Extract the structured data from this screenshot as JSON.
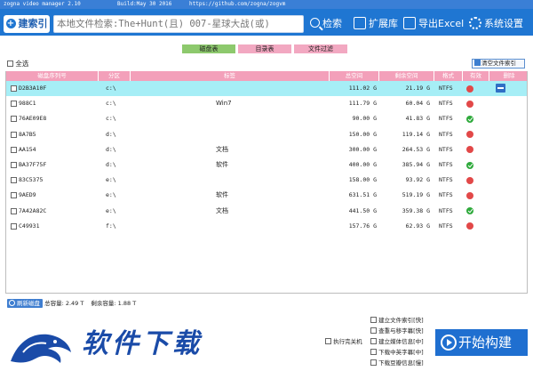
{
  "titlebar": {
    "app": "zogna video manager 2.10",
    "build": "Build:May 30 2016",
    "url": "https://github.com/zogna/zogvm"
  },
  "toolbar": {
    "build_index_label": "建索引",
    "search_placeholder": "本地文件检索:The+Hunt(且) 007-星球大战(或)",
    "search_label": "检索",
    "extensions_label": "扩展库",
    "export_label": "导出Excel",
    "settings_label": "系统设置"
  },
  "tabs": [
    {
      "label": "磁盘表"
    },
    {
      "label": "目录表"
    },
    {
      "label": "文件过滤"
    }
  ],
  "select_all_label": "全选",
  "clear_index_label": "清空文件索引",
  "columns": [
    "磁盘序列号",
    "分区",
    "标签",
    "总空间",
    "剩余空间",
    "格式",
    "有效",
    "删除"
  ],
  "rows": [
    {
      "serial": "D2B3A10F",
      "partition": "c:\\",
      "label": "",
      "total": "111.02 G",
      "free": "21.19 G",
      "format": "NTFS",
      "status": "red",
      "selected": true
    },
    {
      "serial": "988C1",
      "partition": "c:\\",
      "label": "Win7",
      "total": "111.79 G",
      "free": "60.04 G",
      "format": "NTFS",
      "status": "red",
      "selected": false
    },
    {
      "serial": "76AE09E8",
      "partition": "c:\\",
      "label": "",
      "total": "90.00 G",
      "free": "41.83 G",
      "format": "NTFS",
      "status": "green",
      "selected": false
    },
    {
      "serial": "8A7B5",
      "partition": "d:\\",
      "label": "",
      "total": "150.00 G",
      "free": "119.14 G",
      "format": "NTFS",
      "status": "red",
      "selected": false
    },
    {
      "serial": "AA154",
      "partition": "d:\\",
      "label": "文档",
      "total": "300.00 G",
      "free": "264.53 G",
      "format": "NTFS",
      "status": "red",
      "selected": false
    },
    {
      "serial": "BA37F75F",
      "partition": "d:\\",
      "label": "软件",
      "total": "400.00 G",
      "free": "385.94 G",
      "format": "NTFS",
      "status": "green",
      "selected": false
    },
    {
      "serial": "83C5375",
      "partition": "e:\\",
      "label": "",
      "total": "158.00 G",
      "free": "93.92 G",
      "format": "NTFS",
      "status": "red",
      "selected": false
    },
    {
      "serial": "9AED9",
      "partition": "e:\\",
      "label": "软件",
      "total": "631.51 G",
      "free": "519.19 G",
      "format": "NTFS",
      "status": "red",
      "selected": false
    },
    {
      "serial": "7A42A82C",
      "partition": "e:\\",
      "label": "文档",
      "total": "441.50 G",
      "free": "359.38 G",
      "format": "NTFS",
      "status": "green",
      "selected": false
    },
    {
      "serial": "C49931",
      "partition": "f:\\",
      "label": "",
      "total": "157.76 G",
      "free": "62.93 G",
      "format": "NTFS",
      "status": "red",
      "selected": false
    }
  ],
  "footer": {
    "refresh_label": "刷新磁盘",
    "total_capacity": "总容量: 2.49 T",
    "free_capacity": "剩余容量: 1.88 T"
  },
  "watermark": "软件下载",
  "options": [
    {
      "label": "建立文件索引[快]"
    },
    {
      "label": "查重与移字幕[快]"
    },
    {
      "label": "建立媒体信息[中]"
    },
    {
      "label": "下载中英字幕[中]"
    },
    {
      "label": "下载豆瓣信息[慢]"
    }
  ],
  "shutdown_label": "执行完关机",
  "start_label": "开始构建",
  "colors": {
    "primary": "#1f76d2",
    "header_pink": "#f3a0ba",
    "tab_green": "#8dc96d",
    "selected_row": "#a6eef6"
  }
}
